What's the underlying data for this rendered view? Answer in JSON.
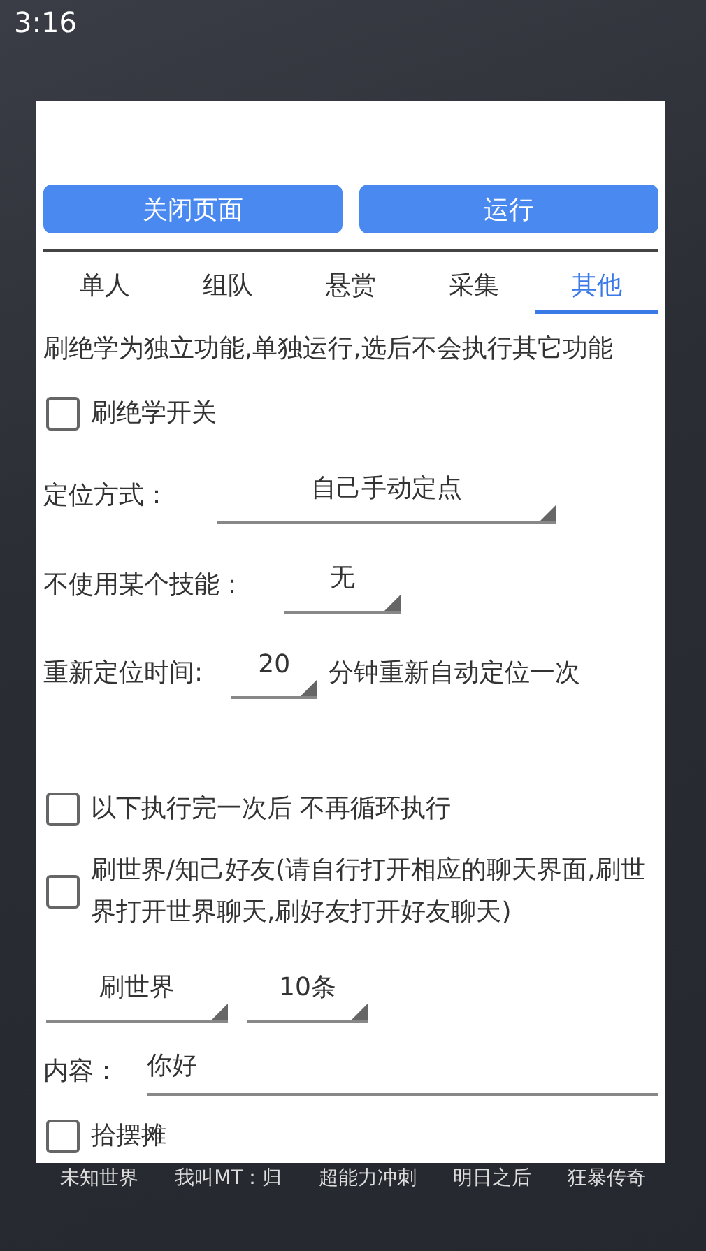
{
  "status_bar": {
    "time": "3:16"
  },
  "buttons": [
    {
      "label": "关闭页面"
    },
    {
      "label": "运行"
    }
  ],
  "tabs": [
    {
      "label": "单人",
      "selected": false
    },
    {
      "label": "组队",
      "selected": false
    },
    {
      "label": "悬赏",
      "selected": false
    },
    {
      "label": "采集",
      "selected": false
    },
    {
      "label": "其他",
      "selected": true
    }
  ],
  "description": "刷绝学为独立功能,单独运行,选后不会执行其它功能",
  "rows": [
    {
      "kind": "checkbox",
      "label": "刷绝学开关",
      "checked": false
    },
    {
      "kind": "select",
      "label": "定位方式：",
      "value": "自己手动定点"
    },
    {
      "kind": "select",
      "label": "不使用某个技能：",
      "value": "无"
    },
    {
      "kind": "select",
      "label": "重新定位时间:",
      "value": "20",
      "suffix": "分钟重新自动定位一次"
    },
    {
      "kind": "checkbox",
      "label": "以下执行完一次后  不再循环执行",
      "checked": false
    },
    {
      "kind": "checkbox",
      "label": "刷世界/知己好友(请自行打开相应的聊天界面,刷世界打开世界聊天,刷好友打开好友聊天)",
      "checked": false
    },
    {
      "kind": "select_pair",
      "values": [
        "刷世界",
        "10条"
      ]
    },
    {
      "kind": "field",
      "label": "内容：",
      "value": "你好"
    },
    {
      "kind": "checkbox",
      "label": "拾摆摊",
      "checked": false
    }
  ],
  "home_apps": [
    "未知世界",
    "我叫MT：归",
    "超能力冲刺",
    "明日之后",
    "狂暴传奇"
  ]
}
